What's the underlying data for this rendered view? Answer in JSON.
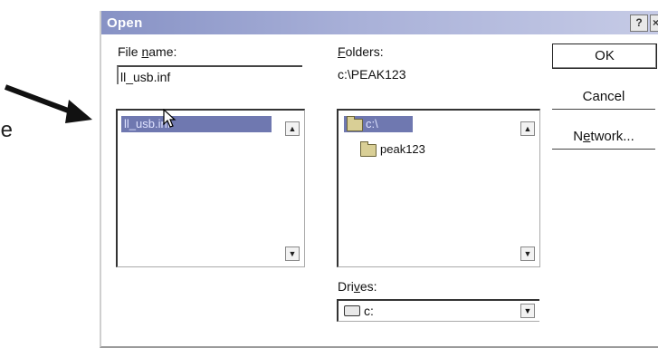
{
  "background_text": "e",
  "dialog": {
    "title": "Open",
    "help_label": "?",
    "close_label": "×"
  },
  "file_name": {
    "label_pre": "File ",
    "label_underlined": "n",
    "label_post": "ame:",
    "value": "ll_usb.inf",
    "items": [
      "ll_usb.inf"
    ],
    "selected": "ll_usb.inf"
  },
  "folders": {
    "label_underlined": "F",
    "label_post": "olders:",
    "current_path": "c:\\PEAK123",
    "items": [
      {
        "label": "c:\\",
        "icon": "open-folder-icon",
        "selected": true
      },
      {
        "label": "peak123",
        "icon": "open-folder-icon",
        "selected": false
      }
    ]
  },
  "drives": {
    "label_pre": "Dri",
    "label_underlined": "v",
    "label_post": "es:",
    "value": "c:",
    "icon": "drive-icon"
  },
  "buttons": {
    "ok": "OK",
    "cancel": "Cancel",
    "network_pre": "N",
    "network_underlined": "e",
    "network_post": "twork..."
  },
  "icons": {
    "scroll_up": "▲",
    "scroll_down": "▼"
  },
  "colors": {
    "titlebar_start": "#8792c5",
    "titlebar_end": "#c6cbe6",
    "selection": "#6f78b0"
  }
}
